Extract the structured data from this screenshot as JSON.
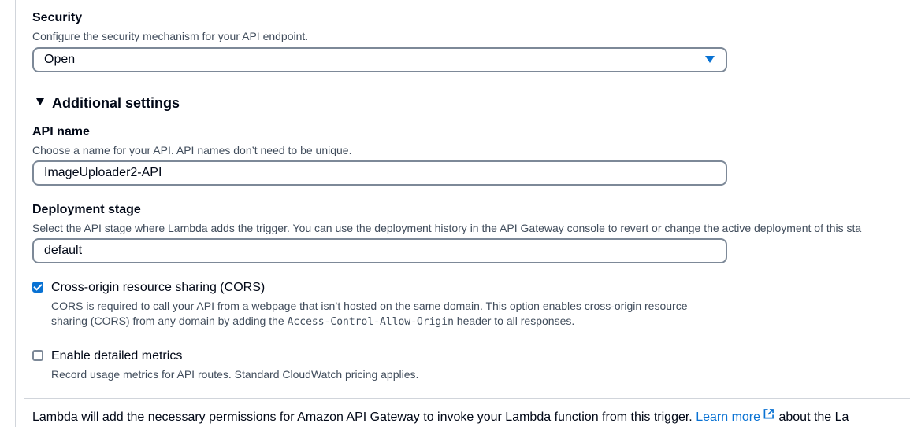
{
  "security": {
    "label": "Security",
    "description": "Configure the security mechanism for your API endpoint.",
    "selected": "Open"
  },
  "additional_settings": {
    "title": "Additional settings",
    "expanded": true
  },
  "api_name": {
    "label": "API name",
    "description": "Choose a name for your API. API names don’t need to be unique.",
    "value": "ImageUploader2-API"
  },
  "deployment_stage": {
    "label": "Deployment stage",
    "description": "Select the API stage where Lambda adds the trigger. You can use the deployment history in the API Gateway console to revert or change the active deployment of this sta",
    "value": "default"
  },
  "cors": {
    "checked": true,
    "label": "Cross-origin resource sharing (CORS)",
    "description_line1": "CORS is required to call your API from a webpage that isn’t hosted on the same domain. This option enables cross-origin resource",
    "description_line2_pre": "sharing (CORS) from any domain by adding the ",
    "description_code": "Access-Control-Allow-Origin",
    "description_line2_post": " header to all responses."
  },
  "detailed_metrics": {
    "checked": false,
    "label": "Enable detailed metrics",
    "description": "Record usage metrics for API routes. Standard CloudWatch pricing applies."
  },
  "footer": {
    "text_pre": "Lambda will add the necessary permissions for Amazon API Gateway to invoke your Lambda function from this trigger. ",
    "link_text": "Learn more",
    "text_post": " about the La"
  },
  "colors": {
    "accent": "#0972d3",
    "border": "#7d8998",
    "text": "#000716",
    "secondary_text": "#414d5c"
  },
  "icons": {
    "dropdown": "caret-down-icon",
    "expand": "triangle-down-icon",
    "external": "external-link-icon",
    "check": "checkmark-icon"
  }
}
